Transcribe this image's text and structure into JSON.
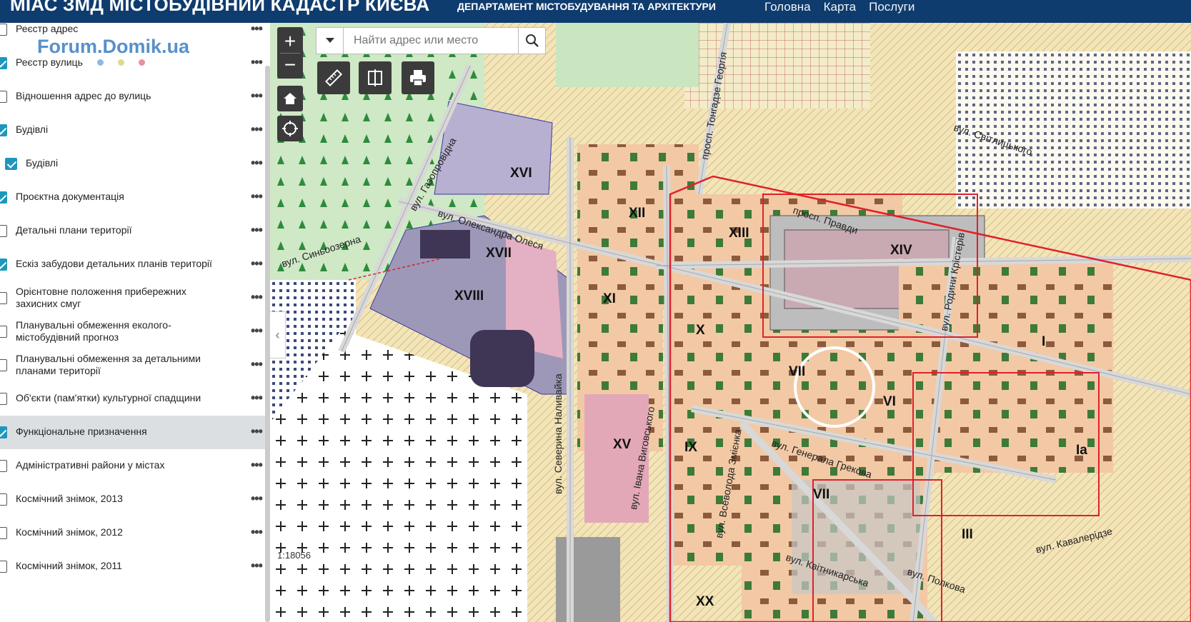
{
  "header": {
    "title": "МІАС ЗМД МІСТОБУДІВНИЙ КАДАСТР КИЄВА",
    "department": "ДЕПАРТАМЕНТ МІСТОБУДУВАННЯ ТА АРХІТЕКТУРИ",
    "nav": [
      "Головна",
      "Карта",
      "Послуги"
    ]
  },
  "watermark": "Forum.Domik.ua",
  "layers": [
    {
      "label": "Реєстр адрес",
      "checked": false
    },
    {
      "label": "Реєстр вулиць",
      "checked": true
    },
    {
      "label": "Відношення адрес до вулиць",
      "checked": false
    },
    {
      "label": "Будівлі",
      "checked": true
    },
    {
      "label": "Будівлі",
      "checked": true
    },
    {
      "label": "Проєктна документація",
      "checked": true
    },
    {
      "label": "Детальні плани території",
      "checked": false
    },
    {
      "label": "Ескіз забудови детальних планів території",
      "checked": true
    },
    {
      "label": "Орієнтовне положення прибережних захисних смуг",
      "checked": false
    },
    {
      "label": "Планувальні обмеження еколого-містобудівний прогноз",
      "checked": false
    },
    {
      "label": "Планувальні обмеження за детальними планами території",
      "checked": false
    },
    {
      "label": "Об'єкти (пам'ятки) культурної спадщини",
      "checked": false
    },
    {
      "label": "Функціональне призначення",
      "checked": true
    },
    {
      "label": "Адміністративні райони у містах",
      "checked": false
    },
    {
      "label": "Космічний знімок, 2013",
      "checked": false
    },
    {
      "label": "Космічний знімок, 2012",
      "checked": false
    },
    {
      "label": "Космічний знімок, 2011",
      "checked": false
    }
  ],
  "street_legend_colors": [
    "#8fb8e0",
    "#d8dc90",
    "#e88ea0"
  ],
  "search": {
    "placeholder": "Найти адрес или место"
  },
  "scale": "1:18056",
  "map_labels": {
    "streets": [
      "вул. Газопровідна",
      "вул. Олександра Олеся",
      "вул. Синьоозерна",
      "просп. Тонгадзе Георгія",
      "просп. Правди",
      "вул. Світлицького",
      "вул. Родини Крістерів",
      "вул. Генерала Грекова",
      "вул. Северина Наливайка",
      "вул. Івана Виговського",
      "вул. Всеволода Змієнка",
      "вул. Квітникарська",
      "вул. Кавалерідзе",
      "вул. Полкова"
    ],
    "districts": [
      "XVI",
      "XVII",
      "XVIII",
      "XII",
      "XIII",
      "XIV",
      "XI",
      "X",
      "VII",
      "VI",
      "I",
      "XV",
      "IX",
      "VII",
      "III",
      "XX",
      "Ia"
    ]
  }
}
